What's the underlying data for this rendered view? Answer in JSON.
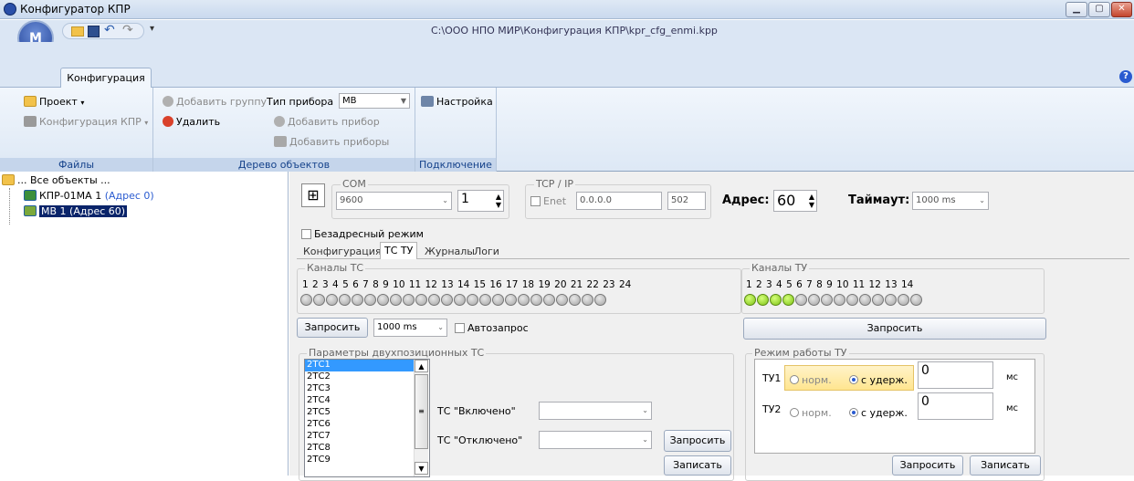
{
  "window": {
    "title": "Конфигуратор КПР",
    "file_path": "C:\\ООО НПО МИР\\Конфигурация КПР\\kpr_cfg_enmi.kpp"
  },
  "ribbon": {
    "tab": "Конфигурация",
    "project": "Проект",
    "kpr_config": "Конфигурация КПР",
    "group_files": "Файлы",
    "add_group": "Добавить группу",
    "delete": "Удалить",
    "device_type_label": "Тип прибора",
    "device_type_value": "МВ",
    "add_device": "Добавить прибор",
    "add_devices": "Добавить приборы",
    "group_tree": "Дерево объектов",
    "settings": "Настройка",
    "group_connection": "Подключение"
  },
  "tree": {
    "root": "... Все объекты ...",
    "items": [
      {
        "name": "КПР-01МА 1",
        "addr": "(Адрес 0)"
      },
      {
        "name": "МВ 1",
        "addr": "(Адрес 60)"
      }
    ]
  },
  "connection": {
    "com_label": "COM",
    "baud": "9600",
    "port": "1",
    "tcp_label": "TCP / IP",
    "enet": "Enet",
    "ip": "0.0.0.0",
    "tcp_port": "502",
    "address_label": "Адрес:",
    "address": "60",
    "timeout_label": "Таймаут:",
    "timeout": "1000 ms",
    "noaddr": "Безадресный режим"
  },
  "tabs": [
    "Конфигурация",
    "ТС ТУ",
    "Журналы",
    "Логи"
  ],
  "tc": {
    "title": "Каналы ТС",
    "numbers": "1  2  3  4  5  6  7  8  9  10 11 12 13 14 15 16 17 18 19 20 21 22 23 24",
    "count": 24
  },
  "tu": {
    "title": "Каналы ТУ",
    "numbers": "1  2  3  4  5  6  7  8  9  10 11 12 13 14",
    "count": 14,
    "on": [
      1,
      2,
      3,
      4
    ]
  },
  "controls": {
    "request": "Запросить",
    "interval": "1000 ms",
    "autorequest": "Автозапрос",
    "request_tu": "Запросить"
  },
  "params": {
    "title": "Параметры двухпозиционных ТС",
    "list": [
      "2ТС1",
      "2ТС2",
      "2ТС3",
      "2ТС4",
      "2ТС5",
      "2ТС6",
      "2ТС7",
      "2ТС8",
      "2ТС9"
    ],
    "on_label": "ТС \"Включено\"",
    "off_label": "ТС \"Отключено\"",
    "request": "Запросить",
    "write": "Записать"
  },
  "tumode": {
    "title": "Режим работы ТУ",
    "rows": [
      {
        "name": "ТУ1",
        "norm": "норм.",
        "hold": "с удерж.",
        "value": "0",
        "unit": "мс"
      },
      {
        "name": "ТУ2",
        "norm": "норм.",
        "hold": "с удерж.",
        "value": "0",
        "unit": "мс"
      }
    ],
    "request": "Запросить",
    "write": "Записать"
  }
}
